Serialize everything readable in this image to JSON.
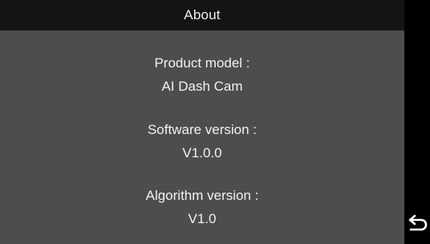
{
  "header": {
    "title": "About"
  },
  "about": {
    "product_model_label": "Product model :",
    "product_model_value": "AI Dash Cam",
    "software_version_label": "Software version :",
    "software_version_value": "V1.0.0",
    "algorithm_version_label": "Algorithm version :",
    "algorithm_version_value": "V1.0"
  },
  "controls": {
    "back_icon": "return-arrow-icon"
  },
  "colors": {
    "title_bar_bg": "#141414",
    "content_bg": "#4d4d4d",
    "text": "#f2f2f2",
    "side_strip_bg": "#000000"
  }
}
